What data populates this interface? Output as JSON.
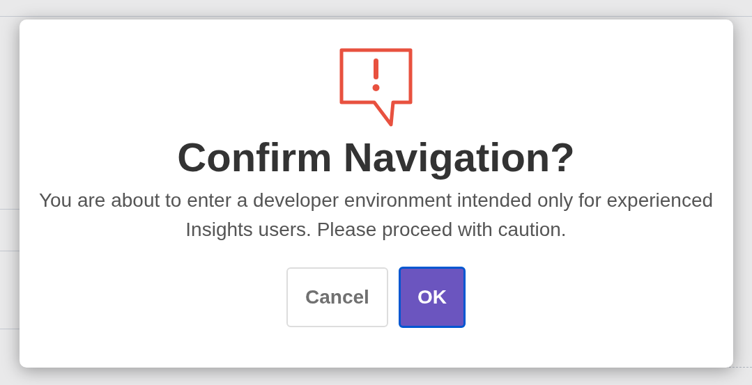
{
  "dialog": {
    "title": "Confirm Navigation?",
    "message": "You are about to enter a developer environment intended only for experienced Insights users. Please proceed with caution.",
    "buttons": [
      {
        "label": "Cancel",
        "kind": "secondary",
        "focused": false
      },
      {
        "label": "OK",
        "kind": "primary",
        "focused": true
      }
    ]
  }
}
